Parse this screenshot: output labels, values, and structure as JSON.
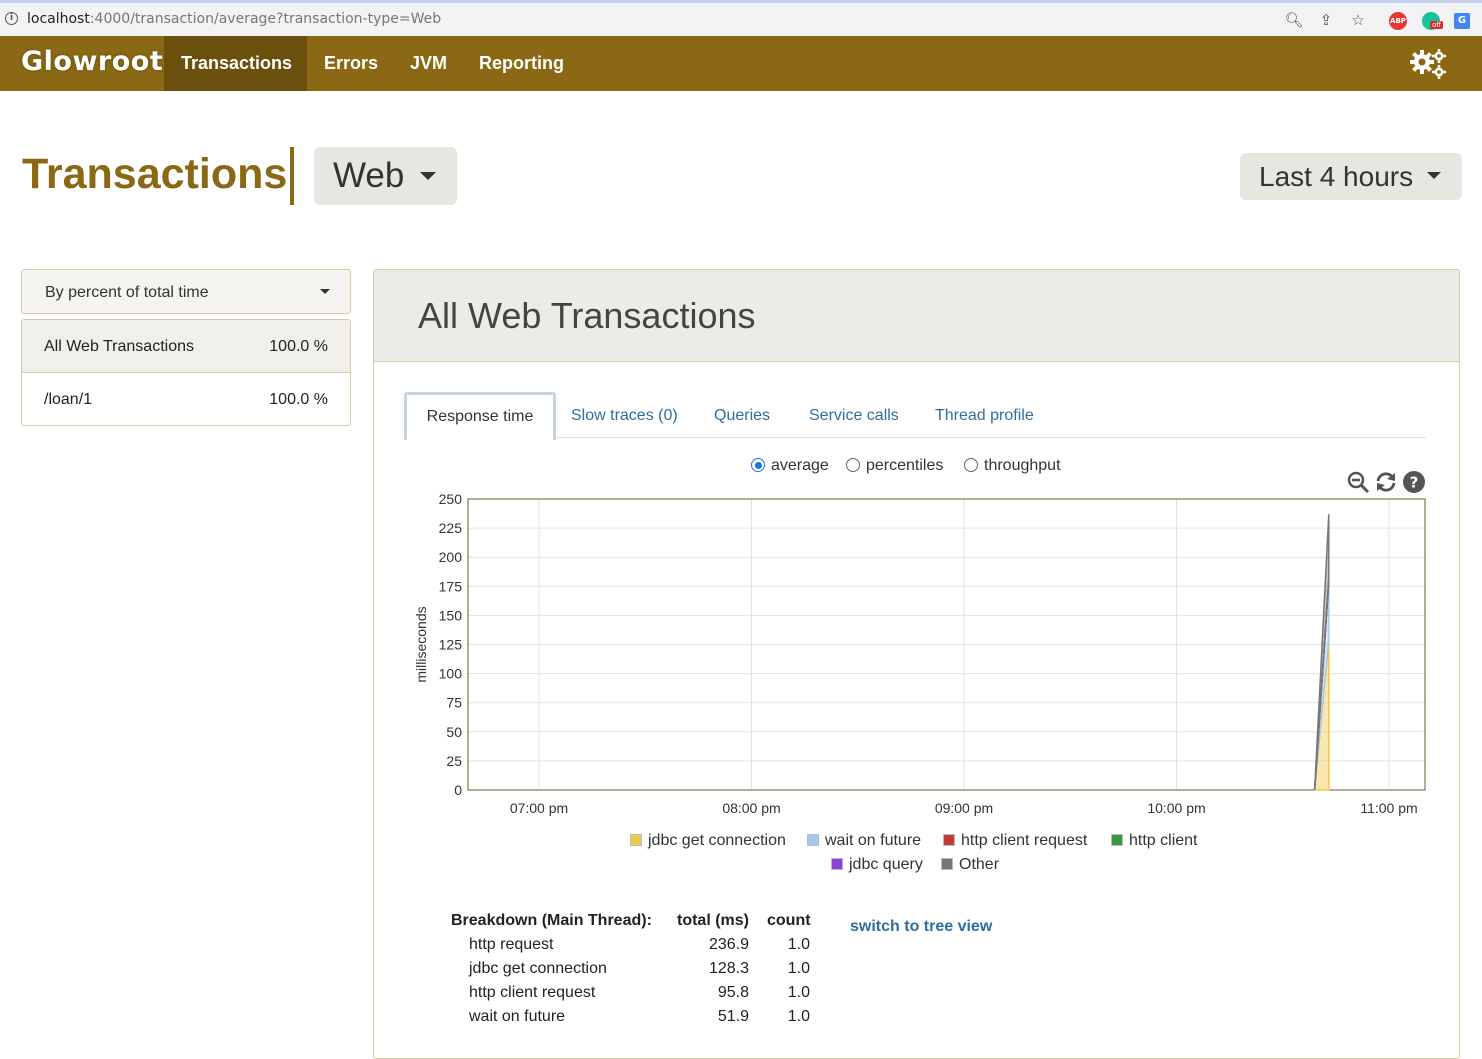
{
  "browser": {
    "url_host": "localhost",
    "url_rest": ":4000/transaction/average?transaction-type=Web"
  },
  "nav": {
    "brand": "Glowroot",
    "items": [
      "Transactions",
      "Errors",
      "JVM",
      "Reporting"
    ],
    "active": "Transactions",
    "brand_color": "#8b6914"
  },
  "header": {
    "title": "Transactions",
    "type_selector": "Web",
    "time_range": "Last 4 hours"
  },
  "sidebar": {
    "sort_label": "By percent of total time",
    "transactions": [
      {
        "name": "All Web Transactions",
        "percent": "100.0 %"
      },
      {
        "name": "/loan/1",
        "percent": "100.0 %"
      }
    ]
  },
  "panel": {
    "title": "All Web Transactions",
    "tabs": [
      "Response time",
      "Slow traces (0)",
      "Queries",
      "Service calls",
      "Thread profile"
    ],
    "radio_options": [
      "average",
      "percentiles",
      "throughput"
    ],
    "radio_selected": "average"
  },
  "chart_data": {
    "type": "area",
    "ylabel": "milliseconds",
    "xlabel": "",
    "ylim": [
      0,
      250
    ],
    "yticks": [
      0,
      25,
      50,
      75,
      100,
      125,
      150,
      175,
      200,
      225,
      250
    ],
    "xticks": [
      "07:00 pm",
      "08:00 pm",
      "09:00 pm",
      "10:00 pm",
      "11:00 pm"
    ],
    "stacked": true,
    "grid": true,
    "legend_position": "bottom",
    "series": [
      {
        "name": "jdbc get connection",
        "color": "#f3c94a",
        "points": [
          [
            "10:39 pm",
            0
          ],
          [
            "10:43 pm",
            128.3
          ]
        ]
      },
      {
        "name": "wait on future",
        "color": "#a6c8ec",
        "points": [
          [
            "10:39 pm",
            0
          ],
          [
            "10:43 pm",
            51.9
          ]
        ]
      },
      {
        "name": "http client request",
        "color": "#c23b3b",
        "points": [
          [
            "10:39 pm",
            0
          ],
          [
            "10:43 pm",
            0.0
          ]
        ]
      },
      {
        "name": "http client",
        "color": "#3a9a3a",
        "points": [
          [
            "10:39 pm",
            0
          ],
          [
            "10:43 pm",
            0.0
          ]
        ]
      },
      {
        "name": "jdbc query",
        "color": "#8b3fe0",
        "points": [
          [
            "10:39 pm",
            0
          ],
          [
            "10:43 pm",
            0.0
          ]
        ]
      },
      {
        "name": "Other",
        "color": "#777777",
        "points": [
          [
            "10:39 pm",
            0
          ],
          [
            "10:43 pm",
            56.7
          ]
        ]
      }
    ]
  },
  "breakdown": {
    "title": "Breakdown (Main Thread):",
    "col_total": "total (ms)",
    "col_count": "count",
    "rows": [
      {
        "name": "http request",
        "total": "236.9",
        "count": "1.0",
        "indent": 0
      },
      {
        "name": "jdbc get connection",
        "total": "128.3",
        "count": "1.0",
        "indent": 1
      },
      {
        "name": "http client request",
        "total": "95.8",
        "count": "1.0",
        "indent": 1
      },
      {
        "name": "wait on future",
        "total": "51.9",
        "count": "1.0",
        "indent": 2
      }
    ],
    "switch_link": "switch to tree view"
  }
}
